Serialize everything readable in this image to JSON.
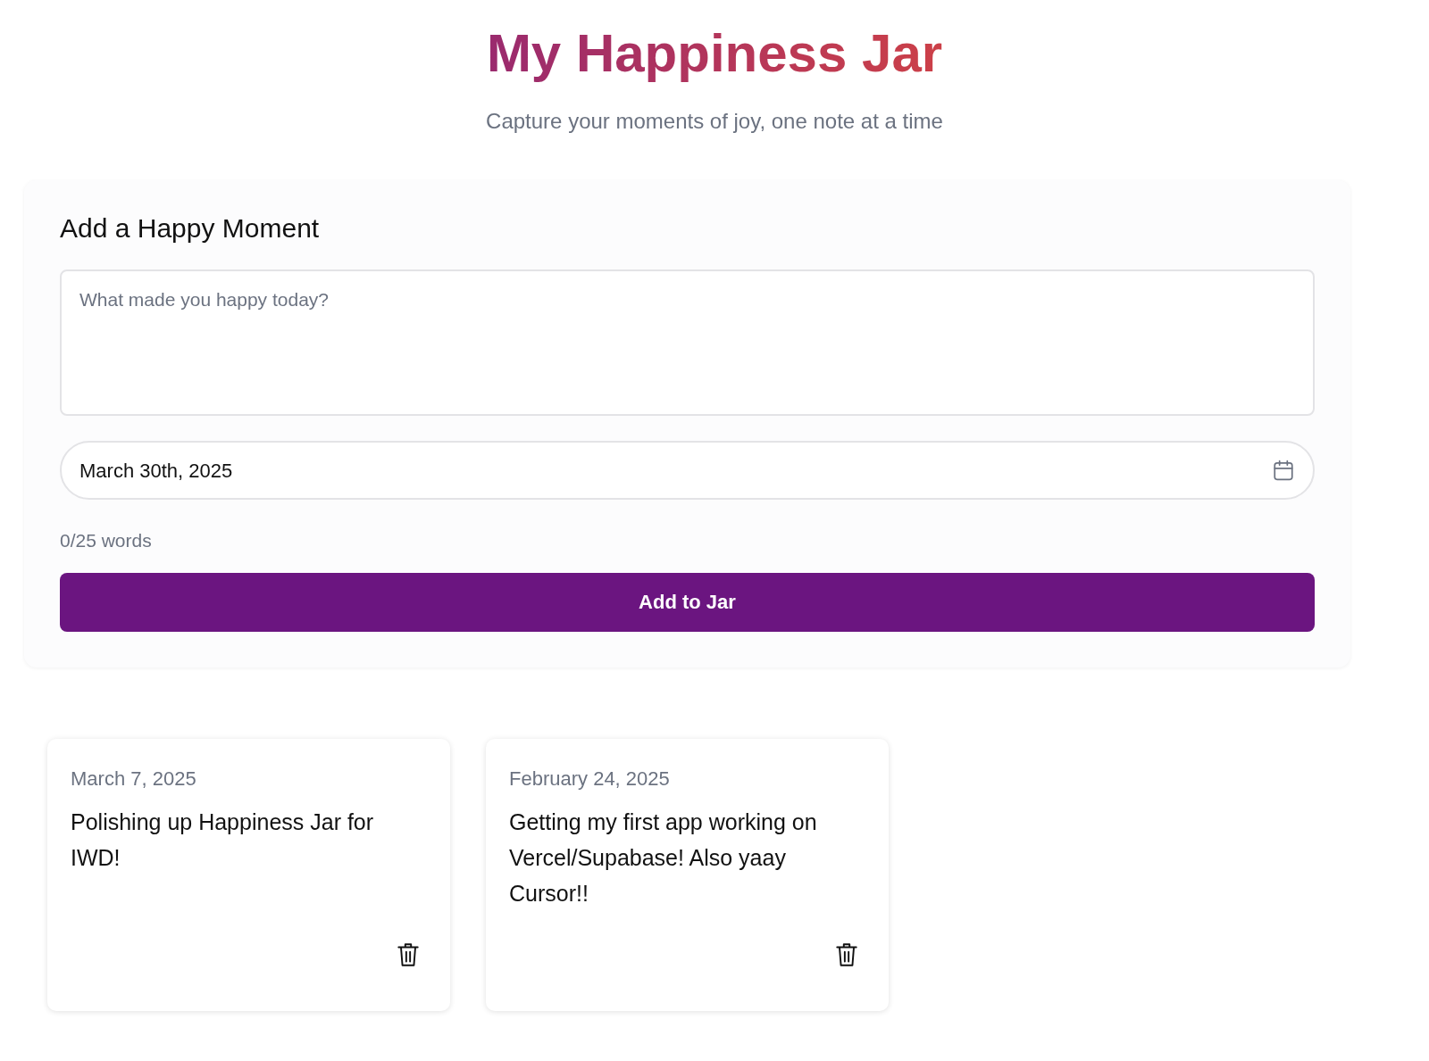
{
  "header": {
    "title": "My Happiness Jar",
    "subtitle": "Capture your moments of joy, one note at a time"
  },
  "form": {
    "heading": "Add a Happy Moment",
    "placeholder": "What made you happy today?",
    "date": "March 30th, 2025",
    "word_count": "0/25 words",
    "submit": "Add to Jar"
  },
  "notes": [
    {
      "date": "March 7, 2025",
      "text": "Polishing up Happiness Jar for IWD!"
    },
    {
      "date": "February 24, 2025",
      "text": "Getting my first app working on Vercel/Supabase! Also yaay Cursor!!"
    }
  ]
}
